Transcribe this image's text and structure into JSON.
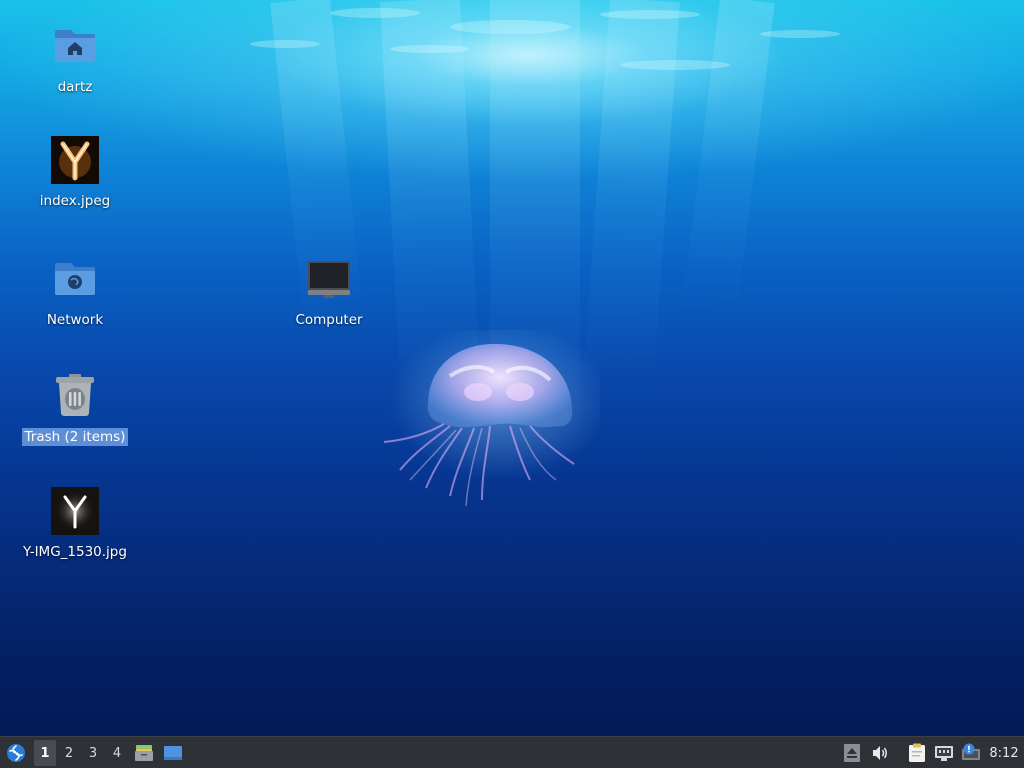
{
  "desktop": {
    "icons": [
      {
        "label": "dartz",
        "icon": "home-folder-icon"
      },
      {
        "label": "index.jpeg",
        "icon": "image-thumbnail-icon"
      },
      {
        "label": "Network",
        "icon": "network-folder-icon"
      },
      {
        "label": "Trash (2 items)",
        "icon": "trash-icon",
        "selected": true
      },
      {
        "label": "Y-IMG_1530.jpg",
        "icon": "image-thumbnail-icon"
      },
      {
        "label": "Computer",
        "icon": "computer-icon"
      }
    ]
  },
  "panel": {
    "menu_icon": "app-menu-icon",
    "workspaces": [
      "1",
      "2",
      "3",
      "4"
    ],
    "active_workspace": "1",
    "launchers": [
      "file-manager-icon",
      "show-desktop-icon"
    ],
    "tray": [
      "eject-icon",
      "volume-icon",
      "clipboard-icon",
      "network-icon",
      "update-notifier-icon"
    ],
    "clock": "8:12"
  },
  "colors": {
    "panel_bg": "#2e3237",
    "selection": "#5c8fd6",
    "folder_blue": "#5b9de3"
  }
}
